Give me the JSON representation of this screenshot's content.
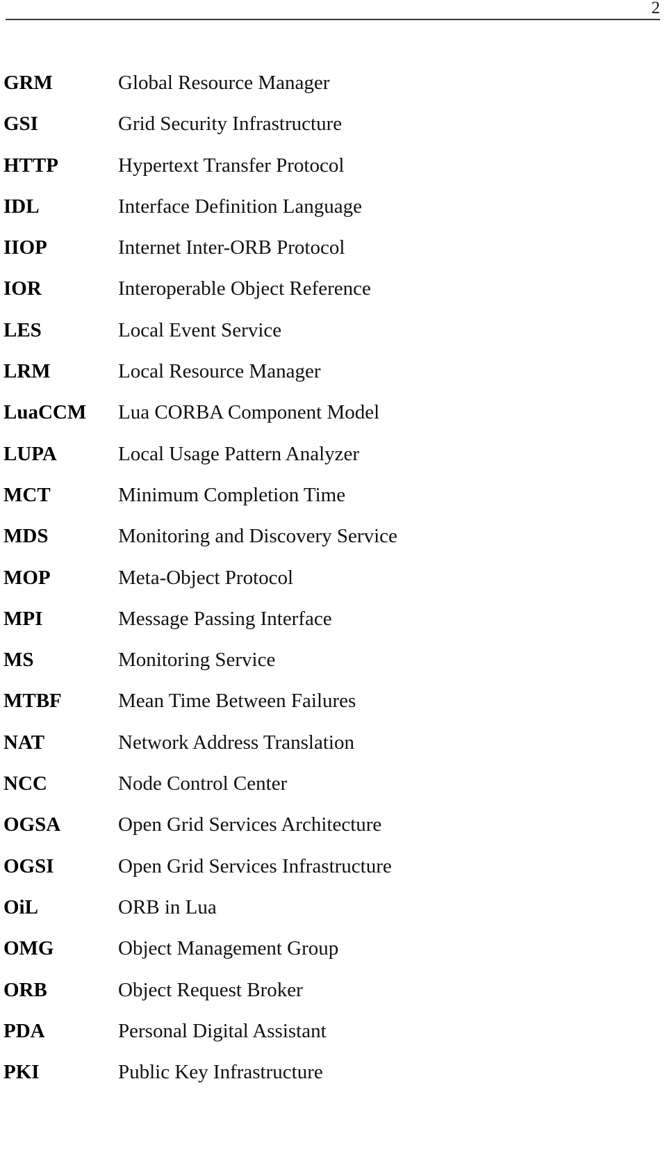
{
  "header": {
    "page_number": "2"
  },
  "glossary": {
    "entries": [
      {
        "term": "GRM",
        "definition": "Global Resource Manager"
      },
      {
        "term": "GSI",
        "definition": "Grid Security Infrastructure"
      },
      {
        "term": "HTTP",
        "definition": "Hypertext Transfer Protocol"
      },
      {
        "term": "IDL",
        "definition": "Interface Definition Language"
      },
      {
        "term": "IIOP",
        "definition": "Internet Inter-ORB Protocol"
      },
      {
        "term": "IOR",
        "definition": "Interoperable Object Reference"
      },
      {
        "term": "LES",
        "definition": "Local Event Service"
      },
      {
        "term": "LRM",
        "definition": "Local Resource Manager"
      },
      {
        "term": "LuaCCM",
        "definition": "Lua CORBA Component Model"
      },
      {
        "term": "LUPA",
        "definition": "Local Usage Pattern Analyzer"
      },
      {
        "term": "MCT",
        "definition": "Minimum Completion Time"
      },
      {
        "term": "MDS",
        "definition": "Monitoring and Discovery Service"
      },
      {
        "term": "MOP",
        "definition": "Meta-Object Protocol"
      },
      {
        "term": "MPI",
        "definition": "Message Passing Interface"
      },
      {
        "term": "MS",
        "definition": "Monitoring Service"
      },
      {
        "term": "MTBF",
        "definition": "Mean Time Between Failures"
      },
      {
        "term": "NAT",
        "definition": "Network Address Translation"
      },
      {
        "term": "NCC",
        "definition": "Node Control Center"
      },
      {
        "term": "OGSA",
        "definition": "Open Grid Services Architecture"
      },
      {
        "term": "OGSI",
        "definition": "Open Grid Services Infrastructure"
      },
      {
        "term": "OiL",
        "definition": "ORB in Lua"
      },
      {
        "term": "OMG",
        "definition": "Object Management Group"
      },
      {
        "term": "ORB",
        "definition": "Object Request Broker"
      },
      {
        "term": "PDA",
        "definition": "Personal Digital Assistant"
      },
      {
        "term": "PKI",
        "definition": "Public Key Infrastructure"
      }
    ]
  }
}
